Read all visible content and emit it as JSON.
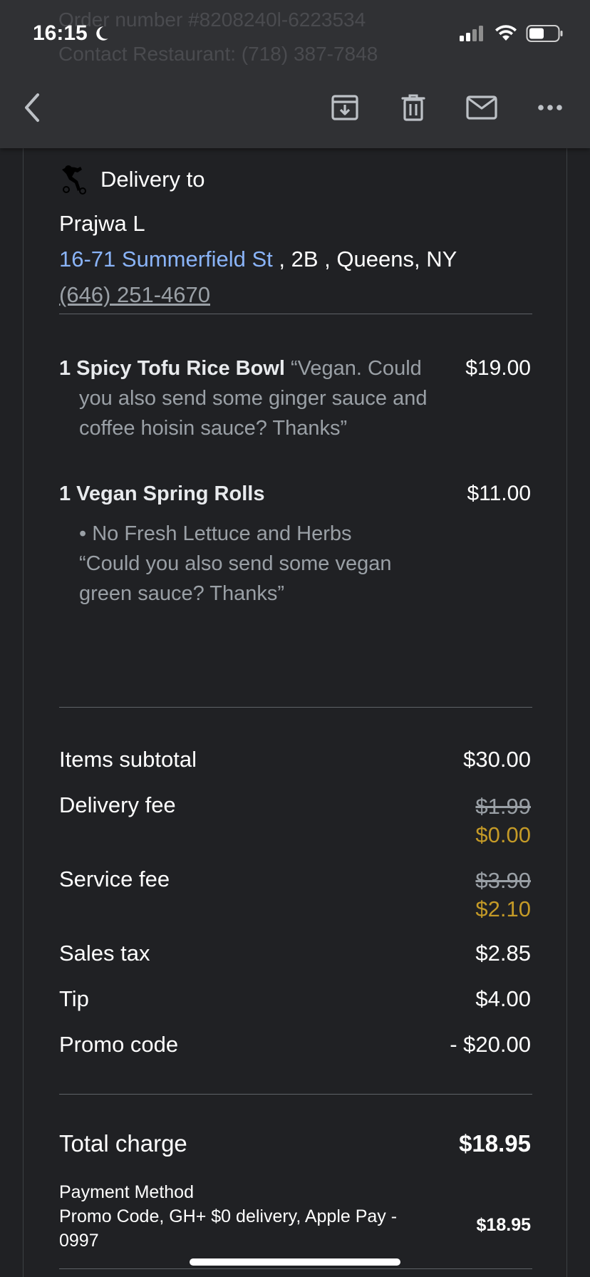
{
  "status_bar": {
    "time": "16:15"
  },
  "header_ghost": {
    "line1": "Order number #8208240l-6223534",
    "line2": "Contact Restaurant: (718) 387-7848"
  },
  "toolbar": {
    "back": "back-icon",
    "archive": "archive-icon",
    "delete": "trash-icon",
    "mail": "mail-icon",
    "more": "more-icon"
  },
  "delivery": {
    "heading": "Delivery to",
    "name": "Prajwa L",
    "street": "16-71 Summerfield St",
    "rest": " , 2B , Queens, NY",
    "phone": "(646) 251-4670"
  },
  "items": [
    {
      "qty_name": "1 Spicy Tofu Rice Bowl",
      "note_inline": " “Vegan. Could",
      "note_rest": "you also send some ginger sauce and coffee hoisin sauce? Thanks”",
      "price": "$19.00"
    },
    {
      "qty_name": "1 Vegan Spring Rolls",
      "option": "• No Fresh Lettuce and Herbs",
      "note": "“Could you also send some vegan green sauce? Thanks”",
      "price": "$11.00"
    }
  ],
  "summary": {
    "subtotal_label": "Items subtotal",
    "subtotal": "$30.00",
    "delivery_label": "Delivery fee",
    "delivery_old": "$1.99",
    "delivery_new": "$0.00",
    "service_label": "Service fee",
    "service_old": "$3.90",
    "service_new": "$2.10",
    "tax_label": "Sales tax",
    "tax": "$2.85",
    "tip_label": "Tip",
    "tip": "$4.00",
    "promo_label": "Promo code",
    "promo": "- $20.00"
  },
  "total": {
    "label": "Total charge",
    "amount": "$18.95"
  },
  "payment": {
    "label": "Payment Method",
    "method": "Promo Code, GH+ $0 delivery, Apple Pay - 0997",
    "amount": "$18.95"
  },
  "colors": {
    "background": "#202124",
    "bar": "#303134",
    "link": "#8ab4f8",
    "discount": "#c49a27"
  }
}
